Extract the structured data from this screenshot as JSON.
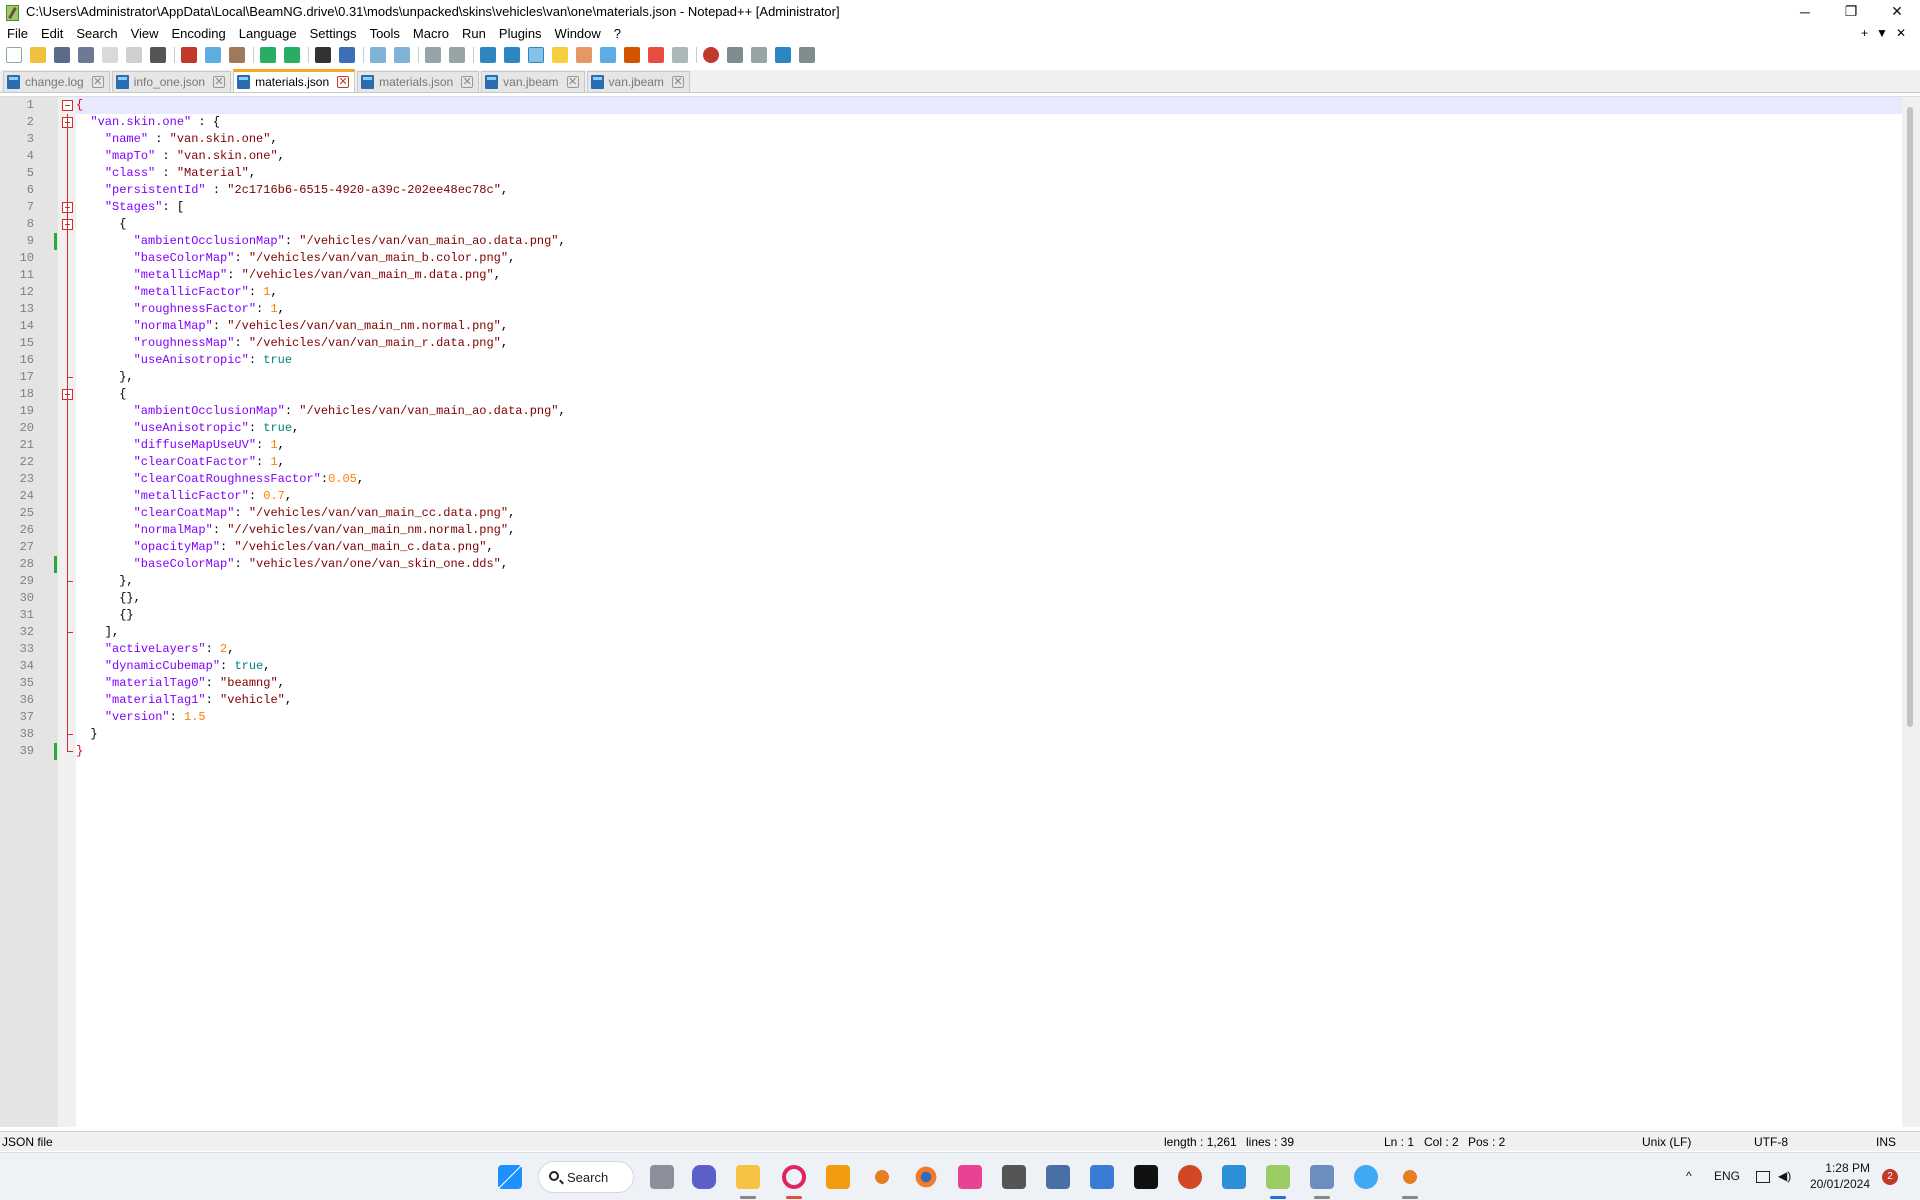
{
  "window": {
    "title": "C:\\Users\\Administrator\\AppData\\Local\\BeamNG.drive\\0.31\\mods\\unpacked\\skins\\vehicles\\van\\one\\materials.json - Notepad++ [Administrator]",
    "minimize_glyph": "─",
    "maximize_glyph": "❐",
    "close_glyph": "✕"
  },
  "menu": {
    "items": [
      "File",
      "Edit",
      "Search",
      "View",
      "Encoding",
      "Language",
      "Settings",
      "Tools",
      "Macro",
      "Run",
      "Plugins",
      "Window",
      "?"
    ],
    "right_plus": "+",
    "right_arrow": "▼",
    "right_close": "✕"
  },
  "tabs": [
    {
      "label": "change.log",
      "active": false
    },
    {
      "label": "info_one.json",
      "active": false
    },
    {
      "label": "materials.json",
      "active": true
    },
    {
      "label": "materials.json",
      "active": false
    },
    {
      "label": "van.jbeam",
      "active": false
    },
    {
      "label": "van.jbeam",
      "active": false
    }
  ],
  "tab_close_glyph": "✕",
  "code_lines": [
    [
      [
        "d",
        "{"
      ]
    ],
    [
      [
        "p",
        "  "
      ],
      [
        "k",
        "\"van.skin.one\""
      ],
      [
        "p",
        " : {"
      ]
    ],
    [
      [
        "p",
        "    "
      ],
      [
        "k",
        "\"name\""
      ],
      [
        "p",
        " : "
      ],
      [
        "s",
        "\"van.skin.one\""
      ],
      [
        "p",
        ","
      ]
    ],
    [
      [
        "p",
        "    "
      ],
      [
        "k",
        "\"mapTo\""
      ],
      [
        "p",
        " : "
      ],
      [
        "s",
        "\"van.skin.one\""
      ],
      [
        "p",
        ","
      ]
    ],
    [
      [
        "p",
        "    "
      ],
      [
        "k",
        "\"class\""
      ],
      [
        "p",
        " : "
      ],
      [
        "s",
        "\"Material\""
      ],
      [
        "p",
        ","
      ]
    ],
    [
      [
        "p",
        "    "
      ],
      [
        "k",
        "\"persistentId\""
      ],
      [
        "p",
        " : "
      ],
      [
        "s",
        "\"2c1716b6-6515-4920-a39c-202ee48ec78c\""
      ],
      [
        "p",
        ","
      ]
    ],
    [
      [
        "p",
        "    "
      ],
      [
        "k",
        "\"Stages\""
      ],
      [
        "p",
        ": ["
      ]
    ],
    [
      [
        "p",
        "      {"
      ]
    ],
    [
      [
        "p",
        "        "
      ],
      [
        "k",
        "\"ambientOcclusionMap\""
      ],
      [
        "p",
        ": "
      ],
      [
        "s",
        "\"/vehicles/van/van_main_ao.data.png\""
      ],
      [
        "p",
        ","
      ]
    ],
    [
      [
        "p",
        "        "
      ],
      [
        "k",
        "\"baseColorMap\""
      ],
      [
        "p",
        ": "
      ],
      [
        "s",
        "\"/vehicles/van/van_main_b.color.png\""
      ],
      [
        "p",
        ","
      ]
    ],
    [
      [
        "p",
        "        "
      ],
      [
        "k",
        "\"metallicMap\""
      ],
      [
        "p",
        ": "
      ],
      [
        "s",
        "\"/vehicles/van/van_main_m.data.png\""
      ],
      [
        "p",
        ","
      ]
    ],
    [
      [
        "p",
        "        "
      ],
      [
        "k",
        "\"metallicFactor\""
      ],
      [
        "p",
        ": "
      ],
      [
        "n",
        "1"
      ],
      [
        "p",
        ","
      ]
    ],
    [
      [
        "p",
        "        "
      ],
      [
        "k",
        "\"roughnessFactor\""
      ],
      [
        "p",
        ": "
      ],
      [
        "n",
        "1"
      ],
      [
        "p",
        ","
      ]
    ],
    [
      [
        "p",
        "        "
      ],
      [
        "k",
        "\"normalMap\""
      ],
      [
        "p",
        ": "
      ],
      [
        "s",
        "\"/vehicles/van/van_main_nm.normal.png\""
      ],
      [
        "p",
        ","
      ]
    ],
    [
      [
        "p",
        "        "
      ],
      [
        "k",
        "\"roughnessMap\""
      ],
      [
        "p",
        ": "
      ],
      [
        "s",
        "\"/vehicles/van/van_main_r.data.png\""
      ],
      [
        "p",
        ","
      ]
    ],
    [
      [
        "p",
        "        "
      ],
      [
        "k",
        "\"useAnisotropic\""
      ],
      [
        "p",
        ": "
      ],
      [
        "b",
        "true"
      ]
    ],
    [
      [
        "p",
        "      },"
      ]
    ],
    [
      [
        "p",
        "      {"
      ]
    ],
    [
      [
        "p",
        "        "
      ],
      [
        "k",
        "\"ambientOcclusionMap\""
      ],
      [
        "p",
        ": "
      ],
      [
        "s",
        "\"/vehicles/van/van_main_ao.data.png\""
      ],
      [
        "p",
        ","
      ]
    ],
    [
      [
        "p",
        "        "
      ],
      [
        "k",
        "\"useAnisotropic\""
      ],
      [
        "p",
        ": "
      ],
      [
        "b",
        "true"
      ],
      [
        "p",
        ","
      ]
    ],
    [
      [
        "p",
        "        "
      ],
      [
        "k",
        "\"diffuseMapUseUV\""
      ],
      [
        "p",
        ": "
      ],
      [
        "n",
        "1"
      ],
      [
        "p",
        ","
      ]
    ],
    [
      [
        "p",
        "        "
      ],
      [
        "k",
        "\"clearCoatFactor\""
      ],
      [
        "p",
        ": "
      ],
      [
        "n",
        "1"
      ],
      [
        "p",
        ","
      ]
    ],
    [
      [
        "p",
        "        "
      ],
      [
        "k",
        "\"clearCoatRoughnessFactor\""
      ],
      [
        "p",
        ":"
      ],
      [
        "n",
        "0.05"
      ],
      [
        "p",
        ","
      ]
    ],
    [
      [
        "p",
        "        "
      ],
      [
        "k",
        "\"metallicFactor\""
      ],
      [
        "p",
        ": "
      ],
      [
        "n",
        "0.7"
      ],
      [
        "p",
        ","
      ]
    ],
    [
      [
        "p",
        "        "
      ],
      [
        "k",
        "\"clearCoatMap\""
      ],
      [
        "p",
        ": "
      ],
      [
        "s",
        "\"/vehicles/van/van_main_cc.data.png\""
      ],
      [
        "p",
        ","
      ]
    ],
    [
      [
        "p",
        "        "
      ],
      [
        "k",
        "\"normalMap\""
      ],
      [
        "p",
        ": "
      ],
      [
        "s",
        "\"//vehicles/van/van_main_nm.normal.png\""
      ],
      [
        "p",
        ","
      ]
    ],
    [
      [
        "p",
        "        "
      ],
      [
        "k",
        "\"opacityMap\""
      ],
      [
        "p",
        ": "
      ],
      [
        "s",
        "\"/vehicles/van/van_main_c.data.png\""
      ],
      [
        "p",
        ","
      ]
    ],
    [
      [
        "p",
        "        "
      ],
      [
        "k",
        "\"baseColorMap\""
      ],
      [
        "p",
        ": "
      ],
      [
        "s",
        "\"vehicles/van/one/van_skin_one.dds\""
      ],
      [
        "p",
        ","
      ]
    ],
    [
      [
        "p",
        "      },"
      ]
    ],
    [
      [
        "p",
        "      {},"
      ]
    ],
    [
      [
        "p",
        "      {}"
      ]
    ],
    [
      [
        "p",
        "    ],"
      ]
    ],
    [
      [
        "p",
        "    "
      ],
      [
        "k",
        "\"activeLayers\""
      ],
      [
        "p",
        ": "
      ],
      [
        "n",
        "2"
      ],
      [
        "p",
        ","
      ]
    ],
    [
      [
        "p",
        "    "
      ],
      [
        "k",
        "\"dynamicCubemap\""
      ],
      [
        "p",
        ": "
      ],
      [
        "b",
        "true"
      ],
      [
        "p",
        ","
      ]
    ],
    [
      [
        "p",
        "    "
      ],
      [
        "k",
        "\"materialTag0\""
      ],
      [
        "p",
        ": "
      ],
      [
        "s",
        "\"beamng\""
      ],
      [
        "p",
        ","
      ]
    ],
    [
      [
        "p",
        "    "
      ],
      [
        "k",
        "\"materialTag1\""
      ],
      [
        "p",
        ": "
      ],
      [
        "s",
        "\"vehicle\""
      ],
      [
        "p",
        ","
      ]
    ],
    [
      [
        "p",
        "    "
      ],
      [
        "k",
        "\"version\""
      ],
      [
        "p",
        ": "
      ],
      [
        "n",
        "1.5"
      ]
    ],
    [
      [
        "p",
        "  }"
      ]
    ],
    [
      [
        "d",
        "}"
      ]
    ]
  ],
  "status": {
    "file_type": "JSON file",
    "length": "length : 1,261",
    "lines": "lines : 39",
    "ln": "Ln : 1",
    "col": "Col : 2",
    "pos": "Pos : 2",
    "eol": "Unix (LF)",
    "encoding": "UTF-8",
    "mode": "INS"
  },
  "taskbar": {
    "search_label": "Search",
    "lang": "ENG",
    "time": "1:28 PM",
    "date": "20/01/2024",
    "notifications": "2",
    "tray_up_glyph": "^"
  },
  "colors": {
    "keyword": "#8000ff",
    "string": "#800000",
    "number": "#ff8000",
    "boolean": "#008080",
    "brace_match": "#e00000",
    "active_tab_accent": "#f5a623"
  }
}
